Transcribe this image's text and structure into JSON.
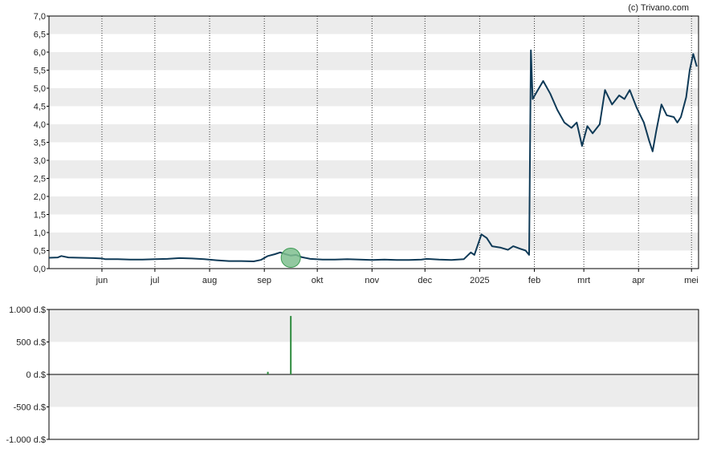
{
  "credit": "(c) Trivano.com",
  "colors": {
    "price_line": "#0f3a57",
    "band": "#ececec",
    "volume_bar": "#2e8b3e",
    "marker_fill": "#7fc08f",
    "marker_stroke": "#3f9b55"
  },
  "chart_data": [
    {
      "type": "line",
      "title": "",
      "xlabel": "",
      "ylabel": "",
      "ylim": [
        0,
        7
      ],
      "y_ticks": [
        "0,0",
        "0,5",
        "1,0",
        "1,5",
        "2,0",
        "2,5",
        "3,0",
        "3,5",
        "4,0",
        "4,5",
        "5,0",
        "5,5",
        "6,0",
        "6,5",
        "7,0"
      ],
      "x_ticks": [
        {
          "label": "jun",
          "x": "2024-06-01"
        },
        {
          "label": "jul",
          "x": "2024-07-01"
        },
        {
          "label": "aug",
          "x": "2024-08-01"
        },
        {
          "label": "sep",
          "x": "2024-09-01"
        },
        {
          "label": "okt",
          "x": "2024-10-01"
        },
        {
          "label": "nov",
          "x": "2024-11-01"
        },
        {
          "label": "dec",
          "x": "2024-12-01"
        },
        {
          "label": "2025",
          "x": "2025-01-01"
        },
        {
          "label": "feb",
          "x": "2025-02-01"
        },
        {
          "label": "mrt",
          "x": "2025-03-01"
        },
        {
          "label": "apr",
          "x": "2025-04-01"
        },
        {
          "label": "mei",
          "x": "2025-05-01"
        }
      ],
      "grid": "vertical dotted lines at month ticks, alternating horizontal bands",
      "marker": {
        "x": "2024-09-16",
        "y": 0.3
      },
      "series": [
        {
          "points": [
            [
              "2024-05-02",
              0.3
            ],
            [
              "2024-05-07",
              0.31
            ],
            [
              "2024-05-09",
              0.35
            ],
            [
              "2024-05-13",
              0.31
            ],
            [
              "2024-05-20",
              0.3
            ],
            [
              "2024-05-27",
              0.29
            ],
            [
              "2024-06-01",
              0.28
            ],
            [
              "2024-06-03",
              0.26
            ],
            [
              "2024-06-10",
              0.26
            ],
            [
              "2024-06-17",
              0.25
            ],
            [
              "2024-06-24",
              0.25
            ],
            [
              "2024-07-01",
              0.26
            ],
            [
              "2024-07-08",
              0.27
            ],
            [
              "2024-07-15",
              0.29
            ],
            [
              "2024-07-22",
              0.28
            ],
            [
              "2024-07-29",
              0.26
            ],
            [
              "2024-08-05",
              0.23
            ],
            [
              "2024-08-12",
              0.21
            ],
            [
              "2024-08-19",
              0.21
            ],
            [
              "2024-08-26",
              0.2
            ],
            [
              "2024-08-30",
              0.24
            ],
            [
              "2024-09-03",
              0.35
            ],
            [
              "2024-09-07",
              0.4
            ],
            [
              "2024-09-10",
              0.45
            ],
            [
              "2024-09-13",
              0.4
            ],
            [
              "2024-09-16",
              0.36
            ],
            [
              "2024-09-19",
              0.38
            ],
            [
              "2024-09-22",
              0.32
            ],
            [
              "2024-09-27",
              0.27
            ],
            [
              "2024-10-04",
              0.25
            ],
            [
              "2024-10-11",
              0.25
            ],
            [
              "2024-10-18",
              0.26
            ],
            [
              "2024-10-25",
              0.25
            ],
            [
              "2024-11-01",
              0.24
            ],
            [
              "2024-11-08",
              0.25
            ],
            [
              "2024-11-15",
              0.24
            ],
            [
              "2024-11-22",
              0.24
            ],
            [
              "2024-11-29",
              0.25
            ],
            [
              "2024-12-02",
              0.27
            ],
            [
              "2024-12-09",
              0.25
            ],
            [
              "2024-12-16",
              0.24
            ],
            [
              "2024-12-23",
              0.26
            ],
            [
              "2024-12-27",
              0.45
            ],
            [
              "2024-12-29",
              0.38
            ],
            [
              "2025-01-02",
              0.95
            ],
            [
              "2025-01-05",
              0.85
            ],
            [
              "2025-01-08",
              0.62
            ],
            [
              "2025-01-13",
              0.58
            ],
            [
              "2025-01-17",
              0.52
            ],
            [
              "2025-01-20",
              0.62
            ],
            [
              "2025-01-24",
              0.55
            ],
            [
              "2025-01-27",
              0.5
            ],
            [
              "2025-01-29",
              0.38
            ],
            [
              "2025-01-30",
              6.05
            ],
            [
              "2025-01-31",
              4.7
            ],
            [
              "2025-02-03",
              4.95
            ],
            [
              "2025-02-06",
              5.2
            ],
            [
              "2025-02-10",
              4.85
            ],
            [
              "2025-02-14",
              4.4
            ],
            [
              "2025-02-18",
              4.05
            ],
            [
              "2025-02-22",
              3.9
            ],
            [
              "2025-02-25",
              4.05
            ],
            [
              "2025-02-28",
              3.4
            ],
            [
              "2025-03-03",
              3.95
            ],
            [
              "2025-03-06",
              3.75
            ],
            [
              "2025-03-10",
              4.0
            ],
            [
              "2025-03-13",
              4.95
            ],
            [
              "2025-03-17",
              4.55
            ],
            [
              "2025-03-21",
              4.8
            ],
            [
              "2025-03-24",
              4.7
            ],
            [
              "2025-03-27",
              4.95
            ],
            [
              "2025-03-31",
              4.45
            ],
            [
              "2025-04-02",
              4.25
            ],
            [
              "2025-04-04",
              4.05
            ],
            [
              "2025-04-07",
              3.55
            ],
            [
              "2025-04-09",
              3.25
            ],
            [
              "2025-04-11",
              3.8
            ],
            [
              "2025-04-14",
              4.55
            ],
            [
              "2025-04-17",
              4.25
            ],
            [
              "2025-04-21",
              4.2
            ],
            [
              "2025-04-23",
              4.05
            ],
            [
              "2025-04-25",
              4.2
            ],
            [
              "2025-04-28",
              4.75
            ],
            [
              "2025-04-30",
              5.5
            ],
            [
              "2025-05-02",
              5.95
            ],
            [
              "2025-05-04",
              5.6
            ]
          ]
        }
      ]
    },
    {
      "type": "bar",
      "title": "",
      "xlabel": "",
      "ylabel": "",
      "ylim": [
        -1000,
        1000
      ],
      "y_ticks": [
        "1.000 d.$",
        "500 d.$",
        "0 d.$",
        "-500 d.$",
        "-1.000 d.$"
      ],
      "bars": [
        {
          "x": "2024-09-03",
          "value": 40
        },
        {
          "x": "2024-09-16",
          "value": 900
        }
      ]
    }
  ]
}
